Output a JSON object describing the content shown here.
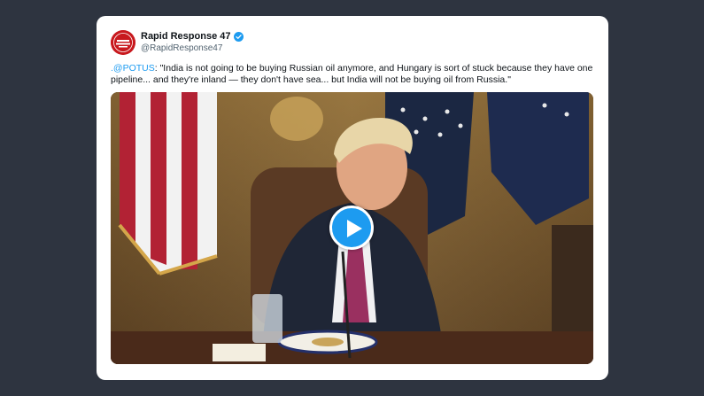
{
  "tweet": {
    "author": {
      "display_name": "Rapid Response 47",
      "handle": "@RapidResponse47",
      "verified": true,
      "avatar_icon": "rapid-response-logo"
    },
    "mention": ".@POTUS",
    "text": ": \"India is not going to be buying Russian oil anymore, and Hungary is sort of stuck because they have one pipeline... and they're inland — they don't have sea... but India will not be buying oil from Russia.\"",
    "media": {
      "type": "video",
      "play_icon": "play-icon"
    }
  },
  "colors": {
    "background": "#2e3440",
    "card": "#ffffff",
    "link": "#1d9bf0",
    "avatar": "#c8191e"
  }
}
